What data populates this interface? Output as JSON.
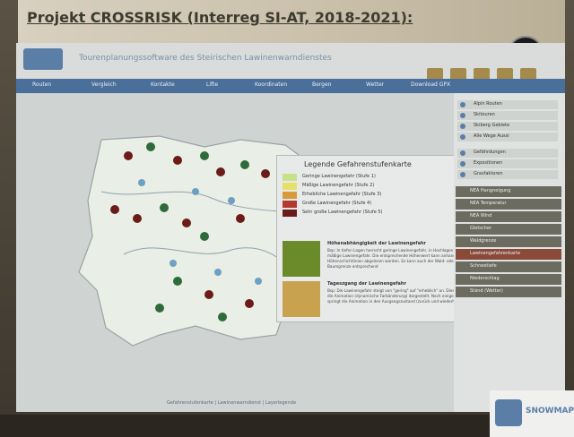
{
  "slide": {
    "title": "Projekt CROSSRISK (Interreg SI-AT, 2018-2021):"
  },
  "app": {
    "subtitle": "Tourenplanungssoftware des Steirischen Lawinenwarndienstes"
  },
  "nav": {
    "items": [
      "Routen",
      "Vergleich",
      "Kontakte",
      "Lifte",
      "Koordinaten",
      "Bergen",
      "Wetter",
      "Download GPX"
    ]
  },
  "legend": {
    "title": "Legende Gefahrenstufenkarte",
    "rows": [
      {
        "label": "Geringe Lawinengefahr (Stufe 1)",
        "color": "#c7e08a"
      },
      {
        "label": "Mäßige Lawinengefahr (Stufe 2)",
        "color": "#e6df6a"
      },
      {
        "label": "Erhebliche Lawinengefahr (Stufe 3)",
        "color": "#d89a3a"
      },
      {
        "label": "Große Lawinengefahr (Stufe 4)",
        "color": "#b23a2e"
      },
      {
        "label": "Sehr große Lawinengefahr (Stufe 5)",
        "color": "#6b1c18"
      }
    ],
    "section1_title": "Höhenabhängigkeit der Lawinengefahr",
    "section1_text": "Bsp: In tiefen Lagen herrscht geringe Lawinengefahr, in Hochlagen herrscht mäßige Lawinengefahr. Die entsprechende Höhenwert kann anhand der Höhenschichtlinien abgelesen werden. Es kann auch der Wald- oder Baumgrenze entsprechend",
    "section2_title": "Tageszgang der Lawinengefahr",
    "section2_text": "Bsp: Die Lawinengefahr steigt von \"gering\" auf \"erheblich\" an. Dies wird durch die Animation (dynamische Farbänderung) dargestellt. Nach einigen Sekunden springt die Animation in den Ausgangszustand (zurück und wiederholt sich)"
  },
  "sidebar": {
    "items": [
      "Alpin Routen",
      "Skitouren",
      "Skiberg Gebiete",
      "Alle Wege Aussi"
    ],
    "items2": [
      "Gefährdungen",
      "Expositionen",
      "Grasfaktoren"
    ],
    "buttons": [
      "NEA Hangneigung",
      "NEA Temperatur",
      "NEA Wind",
      "Gletscher",
      "Waldgrenze",
      "Lawinengefahrenkarte",
      "Schneetiefe",
      "Niederschlag",
      "Ständ (Wetter)"
    ]
  },
  "snowmaps": {
    "label": "SNOWMAPS"
  },
  "map": {
    "footer": "Gefahrenstufenkarte | Lawinenwarndienst | Layerlegende"
  },
  "colors": {
    "nav": "#4a6f9a",
    "danger_marker": "#6b1c18",
    "safe_marker": "#2f6b3a"
  }
}
